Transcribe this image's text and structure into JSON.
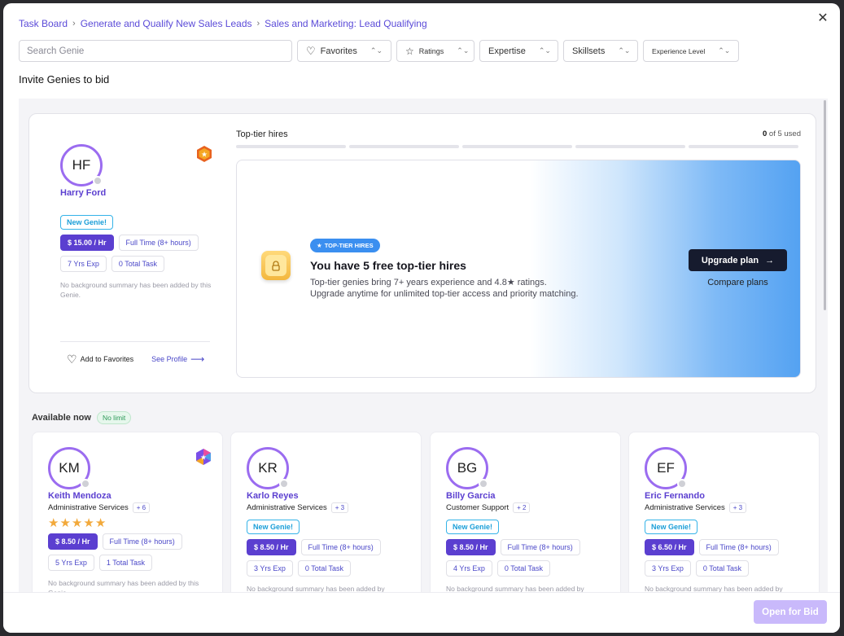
{
  "breadcrumb": {
    "items": [
      "Task Board",
      "Generate and Qualify New Sales Leads",
      "Sales and Marketing: Lead Qualifying"
    ]
  },
  "filters": {
    "search_placeholder": "Search Genie",
    "favorites": "Favorites",
    "ratings": "Ratings",
    "expertise": "Expertise",
    "skillsets": "Skillsets",
    "experience_level": "Experience Level"
  },
  "invite_title": "Invite Genies to bid",
  "featured_genie": {
    "initials": "HF",
    "name": "Harry Ford",
    "badge": "New Genie!",
    "rate": "$ 15.00 / Hr",
    "availability": "Full Time (8+ hours)",
    "experience": "7 Yrs Exp",
    "tasks": "0 Total Task",
    "summary": "No background summary has been added by this Genie.",
    "add_favorites": "Add to Favorites",
    "see_profile": "See Profile"
  },
  "top_tier": {
    "label": "Top-tier hires",
    "used_count": "0",
    "used_suffix": "of 5 used",
    "progress_total": 5,
    "progress_used": 0,
    "pill": "TOP-TIER HIRES",
    "title": "You have 5 free top-tier hires",
    "desc_line1": "Top-tier genies bring 7+ years experience and 4.8★ ratings.",
    "desc_line2": "Upgrade anytime for unlimited top-tier access and priority matching.",
    "upgrade_label": "Upgrade plan",
    "compare_label": "Compare plans"
  },
  "available": {
    "title": "Available now",
    "limit_badge": "No limit"
  },
  "genies": [
    {
      "initials": "KM",
      "name": "Keith Mendoza",
      "service": "Administrative Services",
      "more": "+ 6",
      "rating": 5,
      "rate": "$ 8.50 / Hr",
      "availability": "Full Time (8+ hours)",
      "experience": "5 Yrs Exp",
      "tasks": "1 Total Task",
      "summary": "No background summary has been added by this Genie."
    },
    {
      "initials": "KR",
      "name": "Karlo Reyes",
      "service": "Administrative Services",
      "more": "+ 3",
      "badge": "New Genie!",
      "rate": "$ 8.50 / Hr",
      "availability": "Full Time (8+ hours)",
      "experience": "3 Yrs Exp",
      "tasks": "0 Total Task",
      "summary": "No background summary has been added by"
    },
    {
      "initials": "BG",
      "name": "Billy Garcia",
      "service": "Customer Support",
      "more": "+ 2",
      "badge": "New Genie!",
      "rate": "$ 8.50 / Hr",
      "availability": "Full Time (8+ hours)",
      "experience": "4 Yrs Exp",
      "tasks": "0 Total Task",
      "summary": "No background summary has been added by"
    },
    {
      "initials": "EF",
      "name": "Eric Fernando",
      "service": "Administrative Services",
      "more": "+ 3",
      "badge": "New Genie!",
      "rate": "$ 6.50 / Hr",
      "availability": "Full Time (8+ hours)",
      "experience": "3 Yrs Exp",
      "tasks": "0 Total Task",
      "summary": "No background summary has been added by"
    }
  ],
  "footer": {
    "open_bid": "Open for Bid"
  },
  "colors": {
    "accent": "#5b3fd0",
    "link": "#4a47c8",
    "new_badge": "#1a9ed8",
    "promo_blue": "#54a2f2",
    "primary_dark": "#161b2e",
    "disabled_button": "#c9b9fb"
  }
}
